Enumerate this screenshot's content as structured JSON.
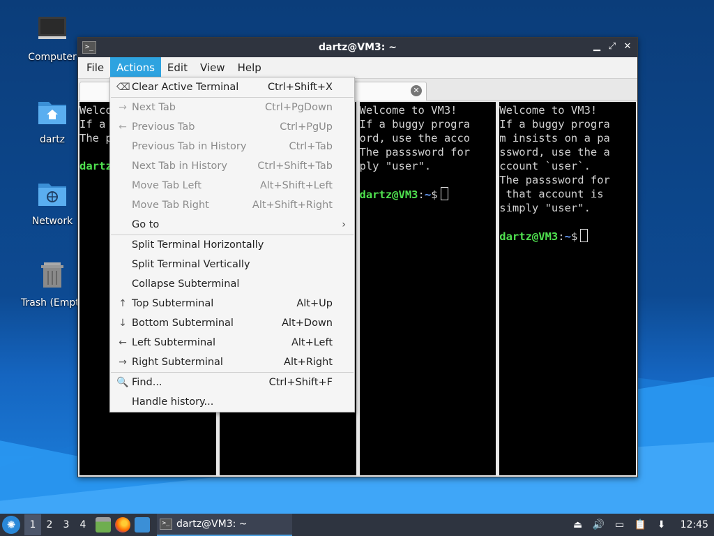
{
  "desktop": {
    "icons": [
      {
        "label": "Computer"
      },
      {
        "label": "dartz"
      },
      {
        "label": "Network"
      },
      {
        "label": "Trash (Empty)"
      }
    ]
  },
  "window": {
    "title": "dartz@VM3: ~",
    "title_icon": ">_",
    "controls": {
      "minimize": "▁",
      "maximize": "⤢",
      "close": "✕"
    }
  },
  "menubar": {
    "items": [
      "File",
      "Actions",
      "Edit",
      "View",
      "Help"
    ],
    "active": "Actions"
  },
  "tab": {
    "close_glyph": "✕"
  },
  "panes": [
    {
      "lines": [
        "Welco",
        "If a",
        "The p",
        ""
      ],
      "user": "dartz",
      "path": ""
    },
    {
      "lines": [],
      "user": "",
      "path": ""
    },
    {
      "lines": [
        "Welcome to VM3!",
        "If a buggy progra",
        "ord, use the acco",
        "The passsword for",
        "ply \"user\".",
        ""
      ],
      "user": "dartz@VM3",
      "path": "~"
    },
    {
      "lines": [
        "Welcome to VM3!",
        "If a buggy progra",
        "m insists on a pa",
        "ssword, use the a",
        "ccount `user`.",
        "The passsword for",
        " that account is",
        "simply \"user\".",
        ""
      ],
      "user": "dartz@VM3",
      "path": "~"
    }
  ],
  "actions_menu": {
    "items": [
      {
        "label": "Clear Active Terminal",
        "shortcut": "Ctrl+Shift+X",
        "icon": "clear-icon",
        "disabled": false
      },
      {
        "sep": true
      },
      {
        "label": "Next Tab",
        "shortcut": "Ctrl+PgDown",
        "icon": "arrow-right-icon",
        "disabled": true
      },
      {
        "label": "Previous Tab",
        "shortcut": "Ctrl+PgUp",
        "icon": "arrow-left-icon",
        "disabled": true
      },
      {
        "label": "Previous Tab in History",
        "shortcut": "Ctrl+Tab",
        "disabled": true
      },
      {
        "label": "Next Tab in History",
        "shortcut": "Ctrl+Shift+Tab",
        "disabled": true
      },
      {
        "label": "Move Tab Left",
        "shortcut": "Alt+Shift+Left",
        "disabled": true
      },
      {
        "label": "Move Tab Right",
        "shortcut": "Alt+Shift+Right",
        "disabled": true
      },
      {
        "label": "Go to",
        "shortcut": "",
        "submenu": true,
        "disabled": false
      },
      {
        "sep": true
      },
      {
        "label": "Split Terminal Horizontally",
        "shortcut": "",
        "disabled": false
      },
      {
        "label": "Split Terminal Vertically",
        "shortcut": "",
        "disabled": false
      },
      {
        "label": "Collapse Subterminal",
        "shortcut": "",
        "disabled": false
      },
      {
        "label": "Top Subterminal",
        "shortcut": "Alt+Up",
        "icon": "arrow-up-icon",
        "disabled": false
      },
      {
        "label": "Bottom Subterminal",
        "shortcut": "Alt+Down",
        "icon": "arrow-down-icon",
        "disabled": false
      },
      {
        "label": "Left Subterminal",
        "shortcut": "Alt+Left",
        "icon": "arrow-left-icon",
        "disabled": false
      },
      {
        "label": "Right Subterminal",
        "shortcut": "Alt+Right",
        "icon": "arrow-right-icon",
        "disabled": false
      },
      {
        "sep": true
      },
      {
        "label": "Find...",
        "shortcut": "Ctrl+Shift+F",
        "icon": "search-icon",
        "disabled": false
      },
      {
        "label": "Handle history...",
        "shortcut": "",
        "disabled": false
      }
    ]
  },
  "taskbar": {
    "workspaces": [
      "1",
      "2",
      "3",
      "4"
    ],
    "current_workspace": "1",
    "task_label": "dartz@VM3: ~",
    "clock": "12:45"
  },
  "colors": {
    "menu_active": "#2ea3e0",
    "prompt_user": "#4fe04f",
    "prompt_path": "#6aa0ff",
    "titlebar": "#2f343f"
  }
}
